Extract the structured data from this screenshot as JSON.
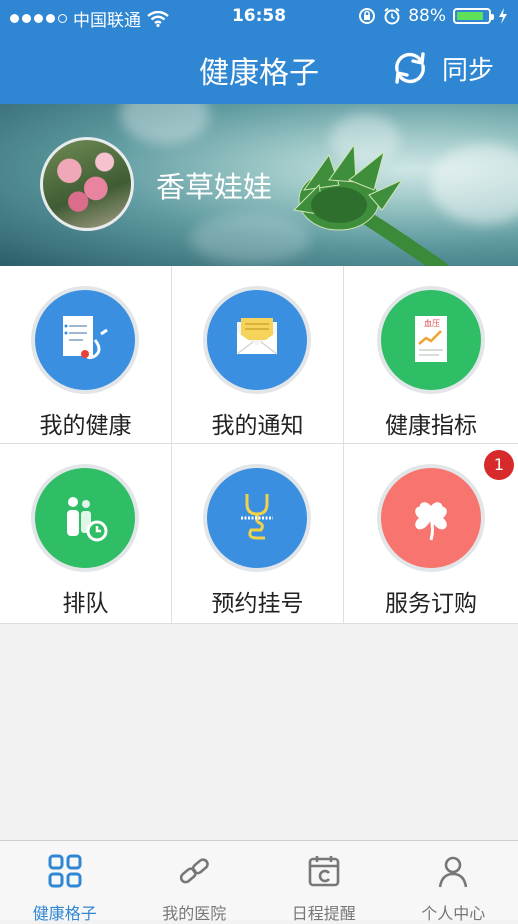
{
  "status_bar": {
    "carrier": "中国联通",
    "time": "16:58",
    "battery_percent": "88%",
    "battery_level": 0.88,
    "signal_bars": 4
  },
  "nav": {
    "title": "健康格子",
    "sync_label": "同步",
    "color": "#2f87d3"
  },
  "profile": {
    "username": "香草娃娃"
  },
  "menu": {
    "items": [
      {
        "label": "我的健康",
        "icon": "health-record-icon",
        "color": "#3a8fe0"
      },
      {
        "label": "我的通知",
        "icon": "envelope-icon",
        "color": "#3a8fe0"
      },
      {
        "label": "健康指标",
        "icon": "blood-pressure-icon",
        "icon_text": "血压",
        "color": "#2fbe66"
      },
      {
        "label": "排队",
        "icon": "queue-icon",
        "color": "#2fbe66"
      },
      {
        "label": "预约挂号",
        "icon": "stethoscope-icon",
        "color": "#3a8fe0"
      },
      {
        "label": "服务订购",
        "icon": "clover-icon",
        "color": "#f7746f",
        "badge": "1"
      }
    ]
  },
  "tabbar": {
    "items": [
      {
        "label": "健康格子",
        "icon": "grid-icon",
        "active": true
      },
      {
        "label": "我的医院",
        "icon": "link-icon",
        "active": false
      },
      {
        "label": "日程提醒",
        "icon": "calendar-icon",
        "active": false
      },
      {
        "label": "个人中心",
        "icon": "person-icon",
        "active": false
      }
    ],
    "active_color": "#2f87d3"
  }
}
